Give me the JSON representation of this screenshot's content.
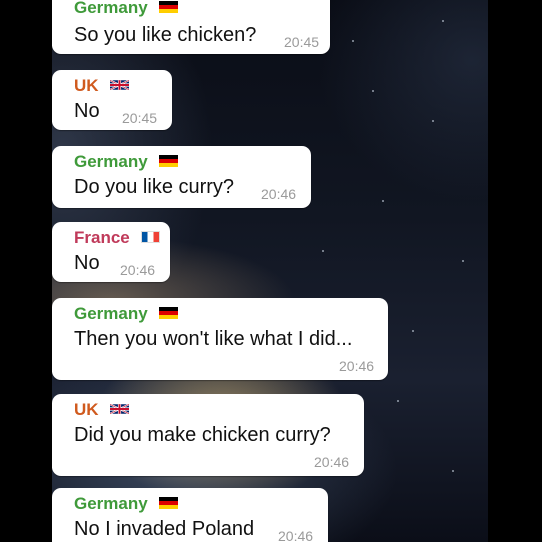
{
  "colors": {
    "germany": "#3f9a3a",
    "uk": "#d05a1e",
    "france": "#c03a5a",
    "bubble": "#ffffff",
    "time": "#9a9a9a"
  },
  "messages": [
    {
      "sender": "Germany",
      "flag": "flag-de",
      "text": "So you like chicken?",
      "time": "20:45"
    },
    {
      "sender": "UK",
      "flag": "flag-uk",
      "text": "No",
      "time": "20:45"
    },
    {
      "sender": "Germany",
      "flag": "flag-de",
      "text": "Do you like curry?",
      "time": "20:46"
    },
    {
      "sender": "France",
      "flag": "flag-fr",
      "text": "No",
      "time": "20:46"
    },
    {
      "sender": "Germany",
      "flag": "flag-de",
      "text": "Then you won't like what I did...",
      "time": "20:46"
    },
    {
      "sender": "UK",
      "flag": "flag-uk",
      "text": "Did you make chicken curry?",
      "time": "20:46"
    },
    {
      "sender": "Germany",
      "flag": "flag-de",
      "text": "No I invaded Poland",
      "time": "20:46"
    }
  ]
}
